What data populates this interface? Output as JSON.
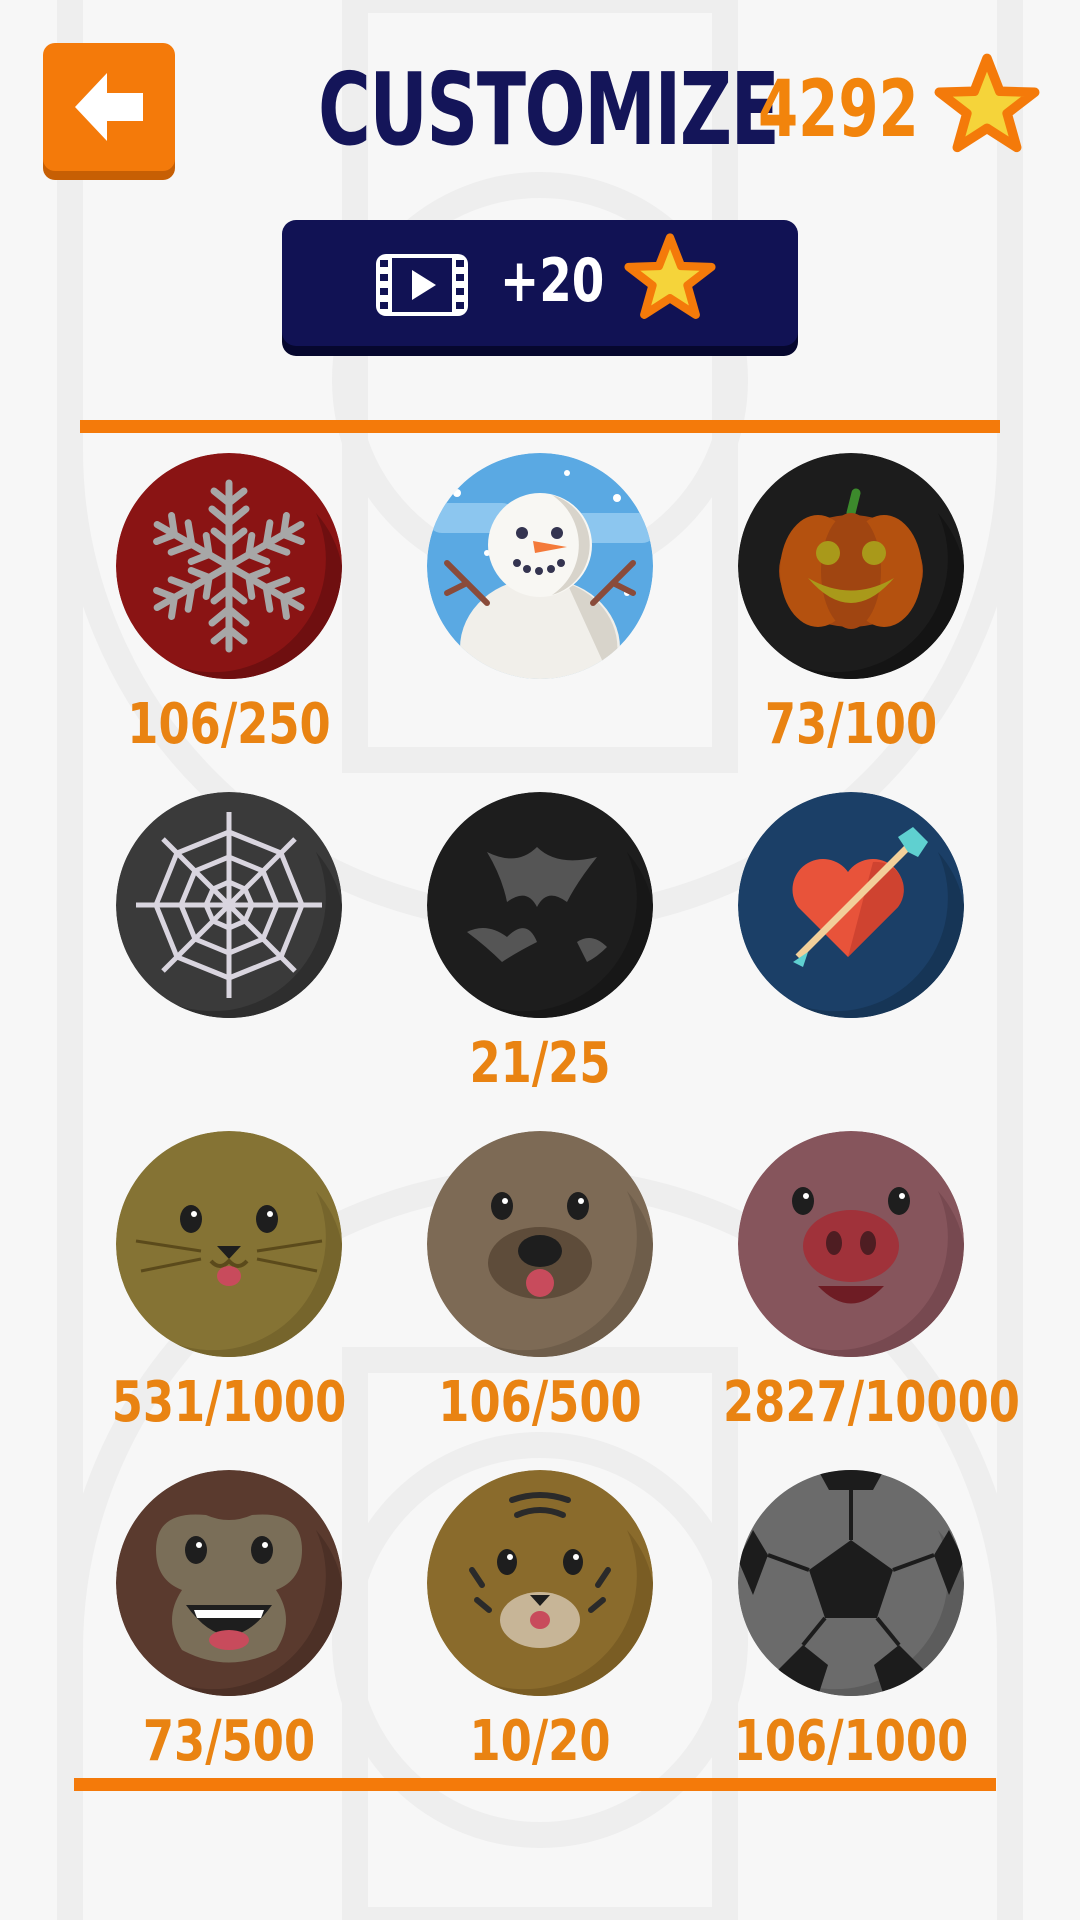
{
  "header": {
    "back_icon": "arrow-left-icon",
    "title": "CUSTOMIZE",
    "coins": "4292",
    "coin_icon": "star-icon"
  },
  "video_reward": {
    "icon": "video-play-icon",
    "label": "+20",
    "reward_icon": "star-icon"
  },
  "colors": {
    "accent_orange": "#f47a0a",
    "navy": "#141559",
    "progress_text": "#e98312"
  },
  "skins": [
    {
      "name": "snowflake",
      "progress": "106/250"
    },
    {
      "name": "snowman",
      "progress": ""
    },
    {
      "name": "pumpkin",
      "progress": "73/100"
    },
    {
      "name": "spider-web",
      "progress": ""
    },
    {
      "name": "bats",
      "progress": "21/25"
    },
    {
      "name": "heart-arrow",
      "progress": ""
    },
    {
      "name": "seal",
      "progress": "531/1000"
    },
    {
      "name": "otter",
      "progress": "106/500"
    },
    {
      "name": "pig",
      "progress": "2827/10000"
    },
    {
      "name": "monkey",
      "progress": "73/500"
    },
    {
      "name": "tiger",
      "progress": "10/20"
    },
    {
      "name": "soccer-ball",
      "progress": "106/1000"
    }
  ]
}
